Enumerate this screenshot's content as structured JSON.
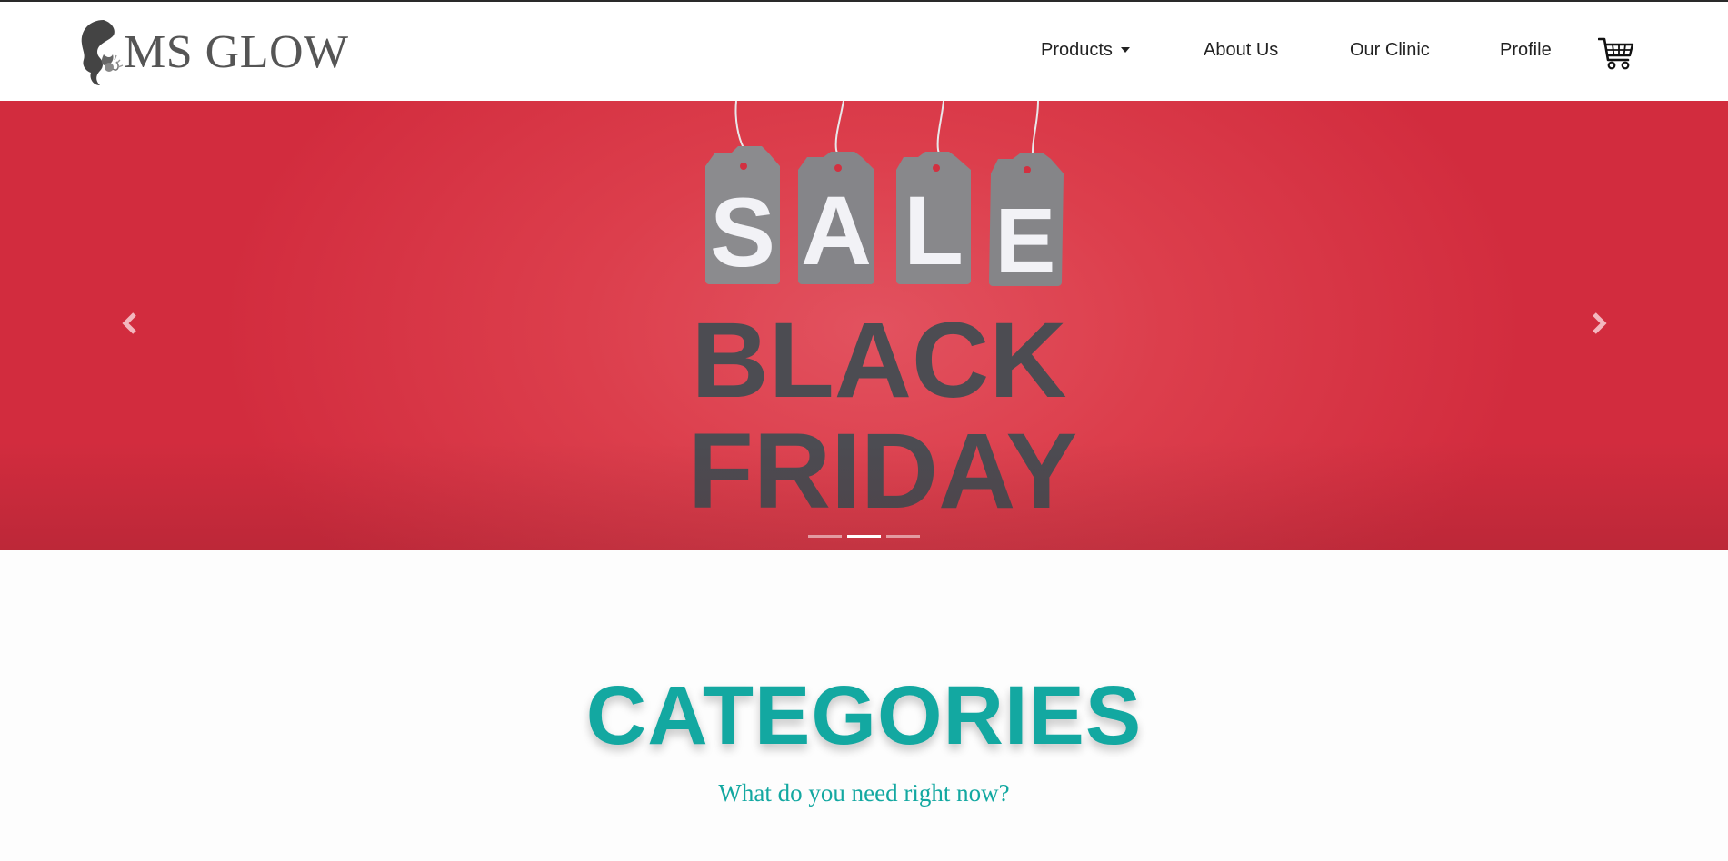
{
  "brand": {
    "name": "MS GLOW",
    "logo_icon": "woman-silhouette-logo-icon"
  },
  "nav": {
    "items": [
      {
        "label": "Products",
        "has_dropdown": true
      },
      {
        "label": "About Us"
      },
      {
        "label": "Our Clinic"
      },
      {
        "label": "Profile"
      }
    ],
    "cart_icon": "shopping-cart-icon"
  },
  "carousel": {
    "slide_text": {
      "tags": [
        "S",
        "A",
        "L",
        "E"
      ],
      "line1": "BLACK",
      "line2": "FRIDAY"
    },
    "prev_icon": "chevron-left-icon",
    "next_icon": "chevron-right-icon",
    "indicator_count": 3,
    "active_indicator": 2,
    "background_color": "#d83444"
  },
  "categories": {
    "title": "CATEGORIES",
    "subtitle": "What do you need right now?",
    "accent_color": "#13a8a1"
  }
}
